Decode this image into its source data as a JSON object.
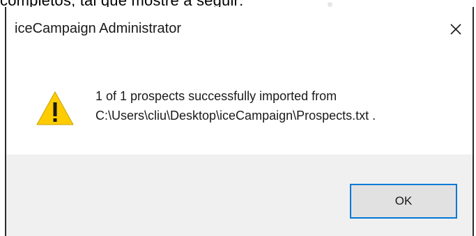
{
  "background_text": "completos, tal que mostre a seguir:",
  "dialog": {
    "title": "iceCampaign Administrator",
    "close_glyph": "✕",
    "icon": "warning-icon",
    "message_line1": "1 of 1 prospects successfully imported from",
    "message_line2": "C:\\Users\\cliu\\Desktop\\iceCampaign\\Prospects.txt .",
    "ok_label": "OK"
  },
  "colors": {
    "accent": "#0078d7",
    "warning_fill": "#ffcc00",
    "footer_bg": "#f0f0f0"
  }
}
